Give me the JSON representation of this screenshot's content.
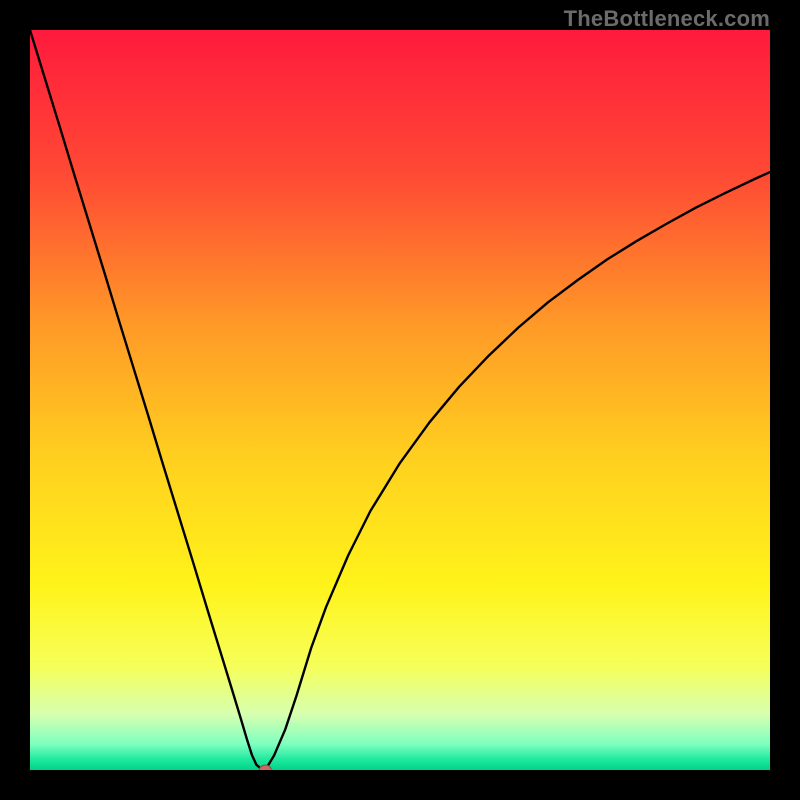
{
  "watermark": "TheBottleneck.com",
  "chart_data": {
    "type": "line",
    "title": "",
    "xlabel": "",
    "ylabel": "",
    "xlim": [
      0,
      100
    ],
    "ylim": [
      0,
      100
    ],
    "grid": false,
    "legend": false,
    "background_gradient": {
      "stops": [
        {
          "offset": 0.0,
          "color": "#ff1a3d"
        },
        {
          "offset": 0.2,
          "color": "#ff4b34"
        },
        {
          "offset": 0.4,
          "color": "#ff9a27"
        },
        {
          "offset": 0.58,
          "color": "#ffd01f"
        },
        {
          "offset": 0.75,
          "color": "#fff31a"
        },
        {
          "offset": 0.86,
          "color": "#f6ff5a"
        },
        {
          "offset": 0.925,
          "color": "#d6ffb0"
        },
        {
          "offset": 0.965,
          "color": "#7effc0"
        },
        {
          "offset": 0.985,
          "color": "#22eaa0"
        },
        {
          "offset": 1.0,
          "color": "#00d28a"
        }
      ]
    },
    "series": [
      {
        "name": "bottleneck-curve",
        "color": "#000000",
        "width": 2.4,
        "x": [
          0,
          2,
          4,
          6,
          8,
          10,
          12,
          14,
          16,
          18,
          20,
          22,
          24,
          26,
          27.5,
          28.5,
          29.3,
          30.0,
          30.6,
          31.2,
          31.8,
          33.0,
          34.5,
          36.0,
          38.0,
          40.0,
          43.0,
          46.0,
          50.0,
          54.0,
          58.0,
          62.0,
          66.0,
          70.0,
          74.0,
          78.0,
          82.0,
          86.0,
          90.0,
          94.0,
          98.0,
          100.0
        ],
        "y": [
          100,
          93.5,
          87.0,
          80.4,
          73.9,
          67.4,
          60.8,
          54.3,
          47.8,
          41.2,
          34.7,
          28.2,
          21.6,
          15.1,
          10.2,
          6.9,
          4.2,
          2.0,
          0.7,
          0.2,
          0.0,
          2.0,
          5.5,
          10.0,
          16.5,
          22.0,
          29.0,
          35.0,
          41.5,
          47.0,
          51.8,
          56.0,
          59.8,
          63.2,
          66.2,
          69.0,
          71.5,
          73.8,
          76.0,
          78.0,
          79.9,
          80.8
        ]
      }
    ],
    "marker": {
      "name": "optimal-point",
      "x": 31.8,
      "y": 0.0,
      "rx": 6,
      "ry": 5,
      "fill": "#d0695c",
      "stroke": "#9c4a40"
    }
  }
}
